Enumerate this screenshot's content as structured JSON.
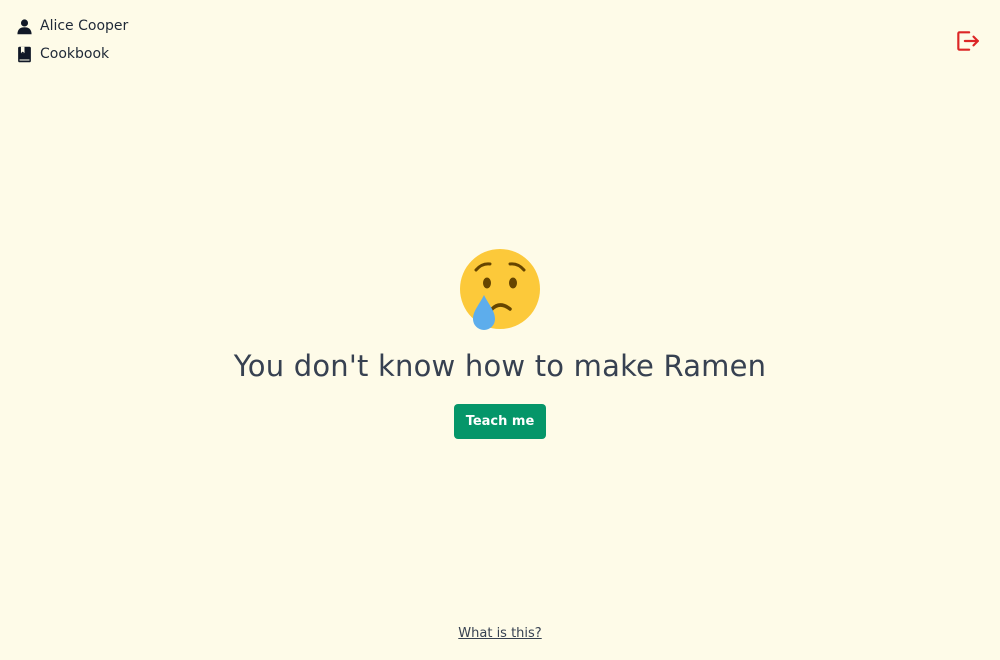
{
  "nav": {
    "items": [
      {
        "label": "Alice Cooper",
        "icon": "user-icon"
      },
      {
        "label": "Cookbook",
        "icon": "book-icon"
      }
    ],
    "logout_icon": "logout-icon"
  },
  "main": {
    "emoji": "crying-face-icon",
    "message": "You don't know how to make Ramen",
    "button_label": "Teach me"
  },
  "footer": {
    "link_label": "What is this?"
  },
  "colors": {
    "background": "#fefbe8",
    "accent_green": "#059669",
    "logout_red": "#dc2626",
    "text": "#374151"
  }
}
